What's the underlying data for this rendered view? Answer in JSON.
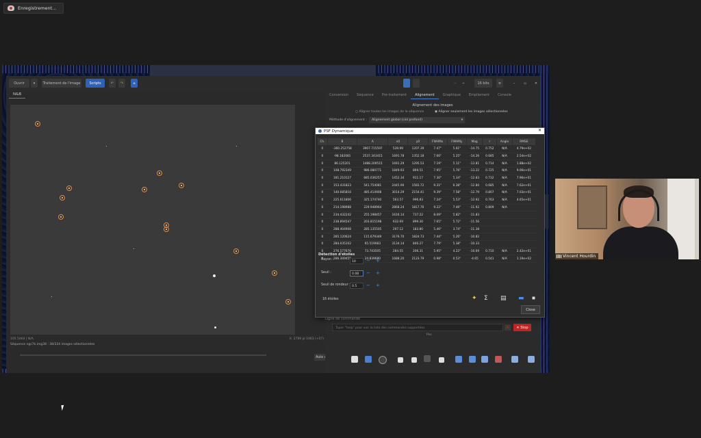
{
  "recording": {
    "label": "Enregistrement..."
  },
  "app": {
    "toolbar": {
      "open": "Ouvrir",
      "image_processing": "Traitement de l'image",
      "scripts": "Scripts",
      "bits": "16 bits"
    },
    "image_tab": "N&B",
    "status_line": "Séquence ngc7k.img38 : 38/334 images sélectionnées",
    "status_small": "105 5464 | N/A",
    "coords_small": "X: 2789 pl 1963 (+07)",
    "auto_adjust": "Auto ajustement",
    "right_tabs": [
      "Conversion",
      "Séquence",
      "Pré-traitement",
      "Alignement",
      "Graphique",
      "Empilement",
      "Console"
    ],
    "active_tab": "Alignement",
    "align_title": "Alignement des images",
    "align_opt1": "Aligner toutes les images de la séquence",
    "align_opt2": "Aligner seulement les images sélectionnées",
    "method_label": "Méthode d'alignement :",
    "method_value": "Alignement global (ciel profond)",
    "cmd_label": "Ligne de commande",
    "cmd_placeholder": "Taper \"help\" pour voir la liste des commandes supportées",
    "stop_label": "Stop",
    "pos_label": "Pos"
  },
  "dialog": {
    "title": "PSF Dynamique",
    "columns": [
      "Ch.",
      "B",
      "A",
      "x0",
      "y0",
      "FWHMx",
      "FWHMy",
      "Mag",
      "r",
      "Angle",
      "RMSE"
    ],
    "rows": [
      [
        "0",
        "-360.252758",
        "3907.715597",
        "539.99",
        "1207.39",
        "7.47\"",
        "5.61\"",
        "-14.75",
        "0.752",
        "N/A",
        "4.79e+02"
      ],
      [
        "0",
        "-98.182081",
        "2537.343415",
        "1691.78",
        "1352.18",
        "7.66\"",
        "5.25\"",
        "-14.26",
        "0.685",
        "N/A",
        "2.54e+02"
      ],
      [
        "0",
        "86.125201",
        "1488.209515",
        "1691.29",
        "1295.53",
        "7.19\"",
        "5.11\"",
        "-13.81",
        "0.714",
        "N/A",
        "1.88e+02"
      ],
      [
        "0",
        "108.792349",
        "986.080771",
        "1849.93",
        "869.51",
        "7.95\"",
        "5.76\"",
        "-13.22",
        "0.725",
        "N/A",
        "9.06e+01"
      ],
      [
        "0",
        "181.210127",
        "685.036257",
        "1452.34",
        "911.17",
        "7.30\"",
        "5.34\"",
        "-12.83",
        "0.732",
        "N/A",
        "7.96e+01"
      ],
      [
        "0",
        "153.431823",
        "541.754081",
        "2445.90",
        "1583.72",
        "9.31\"",
        "6.38\"",
        "-12.80",
        "0.685",
        "N/A",
        "7.62e+01"
      ],
      [
        "0",
        "140.685816",
        "485.414908",
        "3014.29",
        "2154.41",
        "9.39\"",
        "7.58\"",
        "-12.79",
        "0.807",
        "N/A",
        "7.03e+01"
      ],
      [
        "0",
        "225.611806",
        "325.174740",
        "563.57",
        "996.83",
        "7.24\"",
        "5.53\"",
        "-12.92",
        "0.763",
        "N/A",
        "4.65e+01"
      ],
      [
        "0",
        "214.198988",
        "229.948964",
        "2868.24",
        "1817.76",
        "9.22\"",
        "7.46\"",
        "-11.92",
        "0.809",
        "N/A",
        ""
      ],
      [
        "0",
        "234.432242",
        "255.198457",
        "1616.14",
        "737.22",
        "8.09\"",
        "5.82\"",
        "-11.83",
        "",
        "",
        ""
      ],
      [
        "0",
        "238.894547",
        "203.815198",
        "632.69",
        "899.30",
        "7.65\"",
        "5.72\"",
        "-11.56",
        "",
        "",
        ""
      ],
      [
        "0",
        "288.404908",
        "285.135505",
        "297.12",
        "183.80",
        "5.46\"",
        "3.74\"",
        "-11.38",
        "",
        "",
        ""
      ],
      [
        "0",
        "285.120624",
        "115.679349",
        "3176.70",
        "1824.73",
        "7.44\"",
        "5.26\"",
        "-10.82",
        "",
        "",
        ""
      ],
      [
        "0",
        "284.035102",
        "65.519083",
        "3134.14",
        "840.27",
        "7.79\"",
        "5.38\"",
        "-10.33",
        "",
        "",
        ""
      ],
      [
        "0",
        "276.577676",
        "73.743505",
        "284.55",
        "206.31",
        "5.95\"",
        "4.22\"",
        "-10.09",
        "0.710",
        "N/A",
        "2.42e+01"
      ],
      [
        "0",
        "286.309455",
        "24.839680",
        "1688.20",
        "2123.79",
        "0.98\"",
        "0.53\"",
        "-4.65",
        "0.541",
        "N/A",
        "1.19e+02"
      ]
    ],
    "detect_title": "Détection d'étoiles",
    "radius_label": "Rayon :",
    "radius_value": "10",
    "threshold_label": "Seuil :",
    "threshold_value": "0.08",
    "roundness_label": "Seuil de rondeur :",
    "roundness_value": "0.5",
    "stars_count": "16 étoiles",
    "close_label": "Close"
  },
  "video": {
    "name": "Vincent Hourdin"
  }
}
